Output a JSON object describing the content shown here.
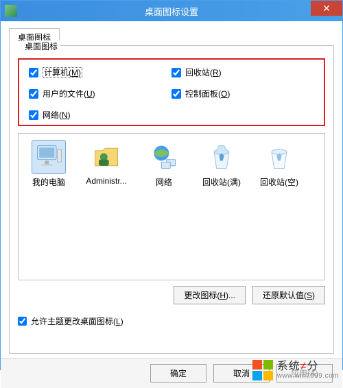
{
  "window": {
    "title": "桌面图标设置",
    "close_symbol": "✕"
  },
  "tab": {
    "label": "桌面图标"
  },
  "fieldset": {
    "label": "桌面图标"
  },
  "checkboxes": {
    "computer": {
      "prefix": "计算机(",
      "mnemonic": "M",
      "suffix": ")",
      "checked": true,
      "focused": true
    },
    "recycle": {
      "prefix": "回收站(",
      "mnemonic": "R",
      "suffix": ")",
      "checked": true
    },
    "userfiles": {
      "prefix": "用户的文件(",
      "mnemonic": "U",
      "suffix": ")",
      "checked": true
    },
    "control": {
      "prefix": "控制面板(",
      "mnemonic": "O",
      "suffix": ")",
      "checked": true
    },
    "network": {
      "prefix": "网络(",
      "mnemonic": "N",
      "suffix": ")",
      "checked": true
    }
  },
  "icons": {
    "computer": "我的电脑",
    "admin": "Administr...",
    "network": "网络",
    "recycle_full": "回收站(满)",
    "recycle_empty": "回收站(空)"
  },
  "buttons": {
    "change_icon": {
      "prefix": "更改图标(",
      "mnemonic": "H",
      "suffix": ")..."
    },
    "restore_default": {
      "prefix": "还原默认值(",
      "mnemonic": "S",
      "suffix": ")"
    }
  },
  "allow_theme": {
    "prefix": "允许主题更改桌面图标(",
    "mnemonic": "L",
    "suffix": ")",
    "checked": true
  },
  "footer": {
    "ok": "确定",
    "cancel": "取消",
    "apply": "应用(A)"
  },
  "watermark": {
    "text_prefix": "系统",
    "text_accent": "≠",
    "text_suffix": "分",
    "url": "www.win7999.com"
  },
  "colors": {
    "highlight_border": "#d92020",
    "titlebar": "#4aa0e8",
    "close": "#c74436",
    "logo_orange": "#f25022",
    "logo_green": "#7fba00",
    "logo_blue": "#00a4ef",
    "logo_yellow": "#ffb900"
  }
}
